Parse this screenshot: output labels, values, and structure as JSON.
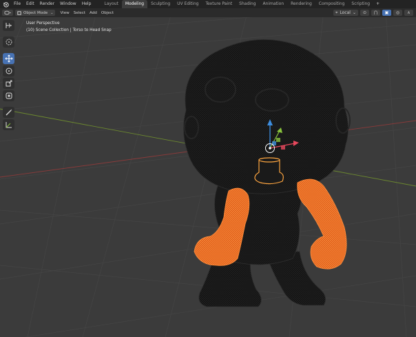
{
  "topbar": {
    "menus": [
      "File",
      "Edit",
      "Render",
      "Window",
      "Help"
    ],
    "workspaces": [
      "Layout",
      "Modeling",
      "Sculpting",
      "UV Editing",
      "Texture Paint",
      "Shading",
      "Animation",
      "Rendering",
      "Compositing",
      "Scripting"
    ],
    "active_workspace": "Modeling",
    "add_label": "+"
  },
  "header": {
    "mode": "Object Mode",
    "menus": [
      "View",
      "Select",
      "Add",
      "Object"
    ],
    "orientation": "Local"
  },
  "viewport": {
    "perspective": "User Perspective",
    "collection": "(10) Scene Collection | Torso to Head Snap"
  },
  "colors": {
    "accent": "#4772b3",
    "selected": "#ff7a1a",
    "x_axis": "#e8485d",
    "y_axis": "#8ac43d",
    "z_axis": "#3d8ee0"
  },
  "tools": [
    "select-box-icon",
    "cursor-icon",
    "move-icon",
    "rotate-icon",
    "scale-icon",
    "transform-icon",
    "annotate-icon",
    "measure-icon"
  ]
}
